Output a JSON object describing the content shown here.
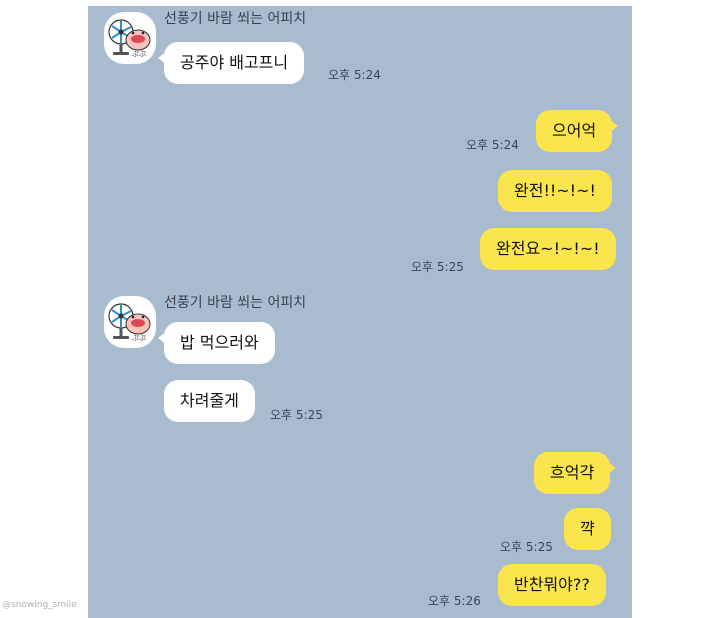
{
  "chat": {
    "background_color": "#a9bbce",
    "incoming_bubble_color": "#ffffff",
    "outgoing_bubble_color": "#fbe54d",
    "sender_name": "선풍기 바람 쐬는 어피치",
    "avatar_icon": "apeach-fan-avatar-icon",
    "messages": {
      "m1": {
        "text": "공주야 배고프니",
        "time": "오후 5:24"
      },
      "m2": {
        "text": "으어억",
        "time": "오후 5:24"
      },
      "m3": {
        "text": "완전!!~!~!"
      },
      "m4": {
        "text": "완전요~!~!~!",
        "time": "오후 5:25"
      },
      "m5": {
        "text": "밥 먹으러와"
      },
      "m6": {
        "text": "차려줄게",
        "time": "오후 5:25"
      },
      "m7": {
        "text": "흐억갹"
      },
      "m8": {
        "text": "꺅",
        "time": "오후 5:25"
      },
      "m9": {
        "text": "반찬뭐야??",
        "time": "오후 5:26"
      }
    }
  },
  "watermark": "@snowing_smile"
}
